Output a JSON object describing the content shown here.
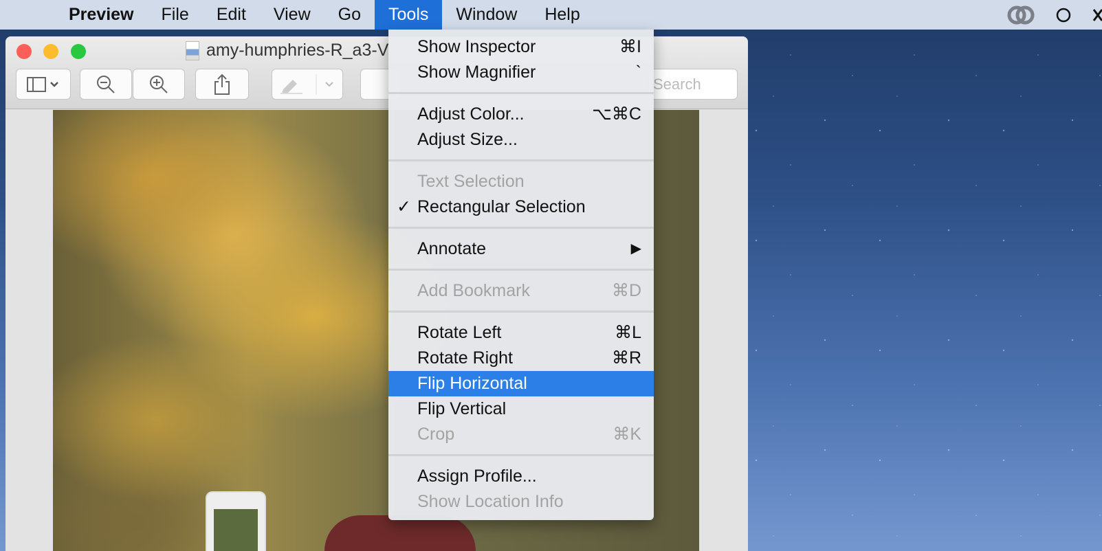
{
  "menubar": {
    "apple": "",
    "app": "Preview",
    "items": [
      "File",
      "Edit",
      "View",
      "Go",
      "Tools",
      "Window",
      "Help"
    ]
  },
  "window": {
    "title": "amy-humphries-R_a3-V",
    "search_placeholder": "Search"
  },
  "menu": {
    "show_inspector": {
      "label": "Show Inspector",
      "shortcut": "⌘I"
    },
    "show_magnifier": {
      "label": "Show Magnifier",
      "shortcut": "`"
    },
    "adjust_color": {
      "label": "Adjust Color...",
      "shortcut": "⌥⌘C"
    },
    "adjust_size": {
      "label": "Adjust Size..."
    },
    "text_selection": {
      "label": "Text Selection"
    },
    "rect_selection": {
      "label": "Rectangular Selection",
      "check": "✓"
    },
    "annotate": {
      "label": "Annotate",
      "arrow": "▶"
    },
    "add_bookmark": {
      "label": "Add Bookmark",
      "shortcut": "⌘D"
    },
    "rotate_left": {
      "label": "Rotate Left",
      "shortcut": "⌘L"
    },
    "rotate_right": {
      "label": "Rotate Right",
      "shortcut": "⌘R"
    },
    "flip_horizontal": {
      "label": "Flip Horizontal"
    },
    "flip_vertical": {
      "label": "Flip Vertical"
    },
    "crop": {
      "label": "Crop",
      "shortcut": "⌘K"
    },
    "assign_profile": {
      "label": "Assign Profile..."
    },
    "show_location": {
      "label": "Show Location Info"
    }
  }
}
